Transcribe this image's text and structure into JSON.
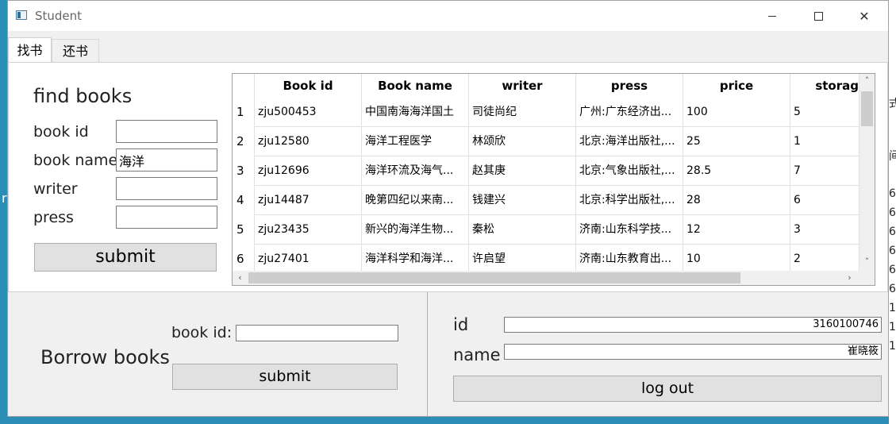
{
  "window": {
    "title": "Student"
  },
  "tabs": [
    {
      "label": "找书"
    },
    {
      "label": "还书"
    }
  ],
  "find": {
    "title": "find books",
    "fields": [
      {
        "label": "book id",
        "value": ""
      },
      {
        "label": "book name",
        "value": "海洋"
      },
      {
        "label": "writer",
        "value": ""
      },
      {
        "label": "press",
        "value": ""
      }
    ],
    "submit_label": "submit"
  },
  "table": {
    "columns": [
      "Book id",
      "Book name",
      "writer",
      "press",
      "price",
      "storag"
    ],
    "rows": [
      {
        "num": "1",
        "cells": [
          "zju500453",
          "中国南海海洋国土",
          "司徒尚纪",
          "广州:广东经济出...",
          "100",
          "5"
        ]
      },
      {
        "num": "2",
        "cells": [
          "zju12580",
          "海洋工程医学",
          "林颂欣",
          "北京:海洋出版社,...",
          "25",
          "1"
        ]
      },
      {
        "num": "3",
        "cells": [
          "zju12696",
          "海洋环流及海气...",
          "赵其庚",
          "北京:气象出版社,...",
          "28.5",
          "7"
        ]
      },
      {
        "num": "4",
        "cells": [
          "zju14487",
          "晚第四纪以来南...",
          "钱建兴",
          "北京:科学出版社,...",
          "28",
          "6"
        ]
      },
      {
        "num": "5",
        "cells": [
          "zju23435",
          "新兴的海洋生物...",
          "秦松",
          "济南:山东科学技...",
          "12",
          "3"
        ]
      },
      {
        "num": "6",
        "cells": [
          "zju27401",
          "海洋科学和海洋...",
          "许启望",
          "济南:山东教育出...",
          "10",
          "2"
        ]
      }
    ]
  },
  "borrow": {
    "title": "Borrow books",
    "bookid_label": "book id:",
    "bookid_value": "",
    "submit_label": "submit"
  },
  "user": {
    "id_label": "id",
    "id_value": "3160100746",
    "name_label": "name",
    "name_value": "崔晓筱",
    "logout_label": "log out"
  },
  "background": {
    "right_fragments": [
      "式",
      "间",
      "6,",
      "6,",
      "6,",
      "6,",
      "6,",
      "6,",
      "1,",
      "1,",
      "1,"
    ],
    "left_glyph": "r"
  }
}
